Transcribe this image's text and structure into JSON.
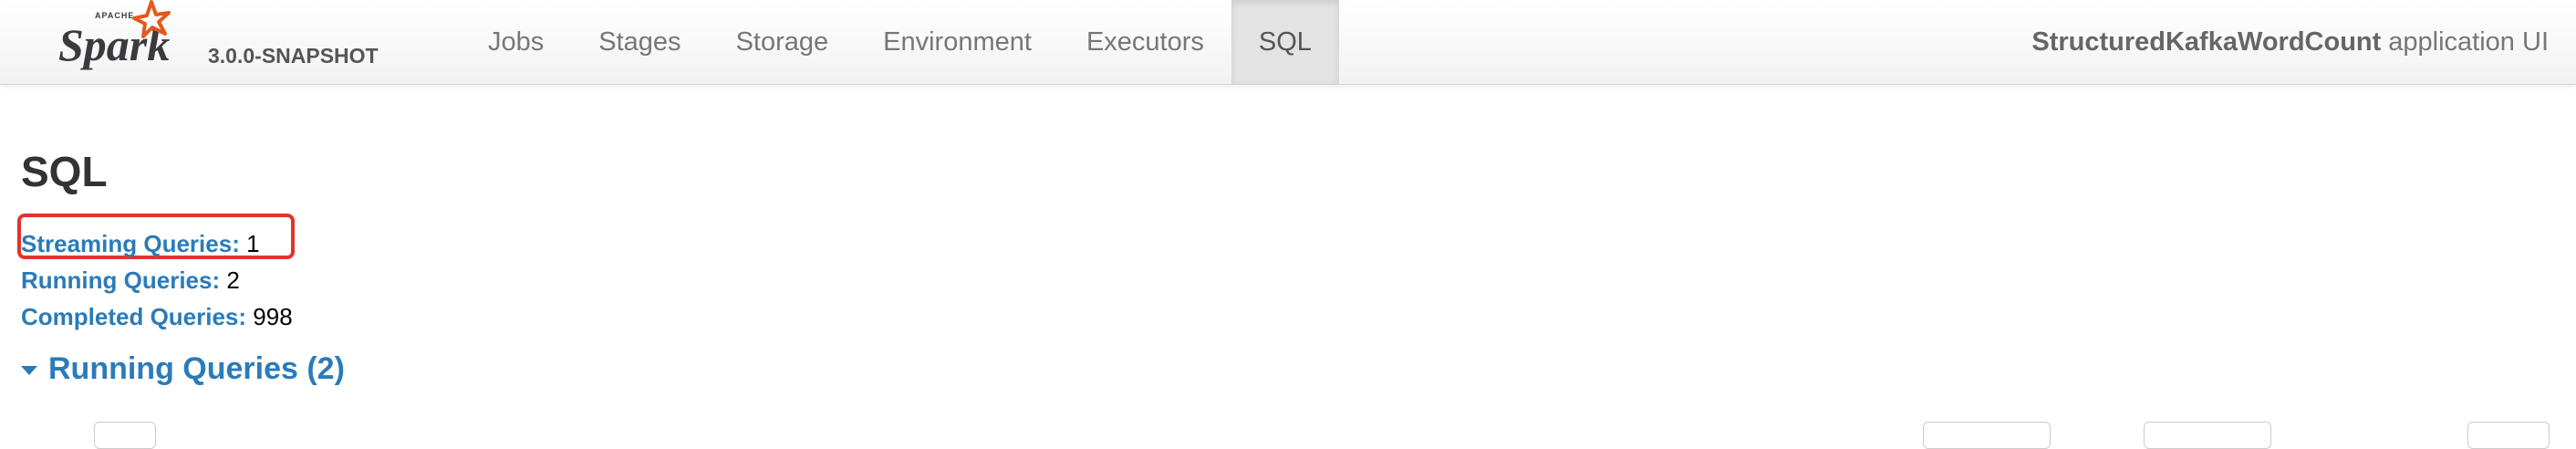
{
  "brand": {
    "top_text": "APACHE",
    "name": "Spark",
    "version": "3.0.0-SNAPSHOT",
    "logo_colors": {
      "text": "#3c3a3e",
      "star": "#e25a1c"
    }
  },
  "nav": {
    "tabs": [
      {
        "label": "Jobs"
      },
      {
        "label": "Stages"
      },
      {
        "label": "Storage"
      },
      {
        "label": "Environment"
      },
      {
        "label": "Executors"
      },
      {
        "label": "SQL",
        "active": true
      }
    ]
  },
  "app": {
    "name": "StructuredKafkaWordCount",
    "suffix": "application UI"
  },
  "page": {
    "title": "SQL"
  },
  "summary": {
    "streaming": {
      "label": "Streaming Queries:",
      "value": "1"
    },
    "running": {
      "label": "Running Queries:",
      "value": "2"
    },
    "completed": {
      "label": "Completed Queries:",
      "value": "998"
    }
  },
  "section": {
    "title": "Running Queries (2)",
    "expanded": true
  },
  "colors": {
    "link": "#2b7bb9",
    "highlight": "#e1332c",
    "active_tab_bg": "#e3e3e3"
  }
}
